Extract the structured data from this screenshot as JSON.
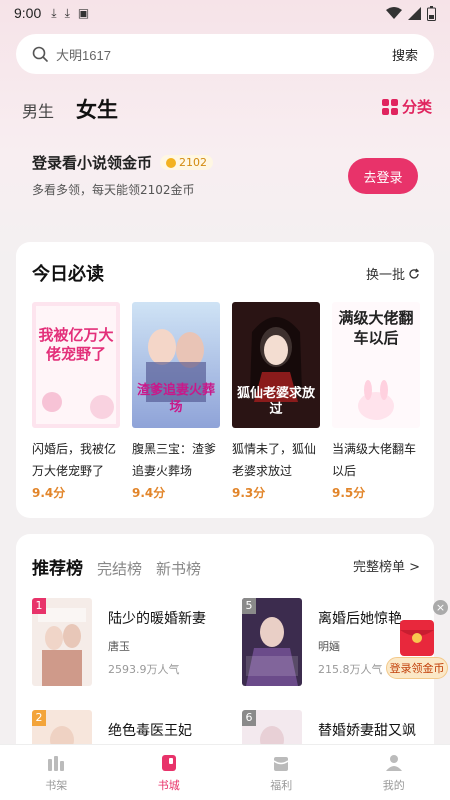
{
  "status_bar": {
    "time": "9:00"
  },
  "search": {
    "placeholder": "大明1617",
    "button": "搜索"
  },
  "gender_tabs": {
    "male": "男生",
    "female": "女生"
  },
  "category": {
    "label": "分类"
  },
  "login_banner": {
    "title": "登录看小说领金币",
    "coins": "2102",
    "subtitle": "多看多领，每天能领2102金币",
    "button": "去登录"
  },
  "today": {
    "title": "今日必读",
    "refresh": "换一批",
    "books": [
      {
        "title": "闪婚后，我被亿万大佬宠野了",
        "score": "9.4分",
        "cover_text": "我被亿万大佬宠野了"
      },
      {
        "title": "腹黑三宝：渣爹追妻火葬场",
        "score": "9.4分",
        "cover_text": "渣爹追妻火葬场"
      },
      {
        "title": "狐情未了，狐仙老婆求放过",
        "score": "9.3分",
        "cover_text": "狐仙老婆求放过"
      },
      {
        "title": "当满级大佬翻车以后",
        "score": "9.5分",
        "cover_text": "满级大佬翻车以后"
      }
    ]
  },
  "ranking": {
    "tabs": [
      "推荐榜",
      "完结榜",
      "新书榜"
    ],
    "full": "完整榜单 >",
    "items": [
      {
        "rank": "1",
        "name": "陆少的暖婚新妻",
        "author": "唐玉",
        "popularity": "2593.9万人气"
      },
      {
        "rank": "5",
        "name": "离婚后她惊艳",
        "author": "明婳",
        "popularity": "215.8万人气"
      },
      {
        "rank": "2",
        "name": "绝色毒医王妃",
        "author": "",
        "popularity": ""
      },
      {
        "rank": "6",
        "name": "替婚娇妻甜又飒",
        "author": "",
        "popularity": ""
      }
    ]
  },
  "float_ad": {
    "label": "登录领金币"
  },
  "bottom_nav": [
    {
      "label": "书架",
      "icon": "bookshelf-icon"
    },
    {
      "label": "书城",
      "icon": "bookstore-icon"
    },
    {
      "label": "福利",
      "icon": "gift-icon"
    },
    {
      "label": "我的",
      "icon": "person-icon"
    }
  ],
  "colors": {
    "accent": "#e8336a",
    "score": "#e2852a",
    "coin": "#f3b21e"
  }
}
